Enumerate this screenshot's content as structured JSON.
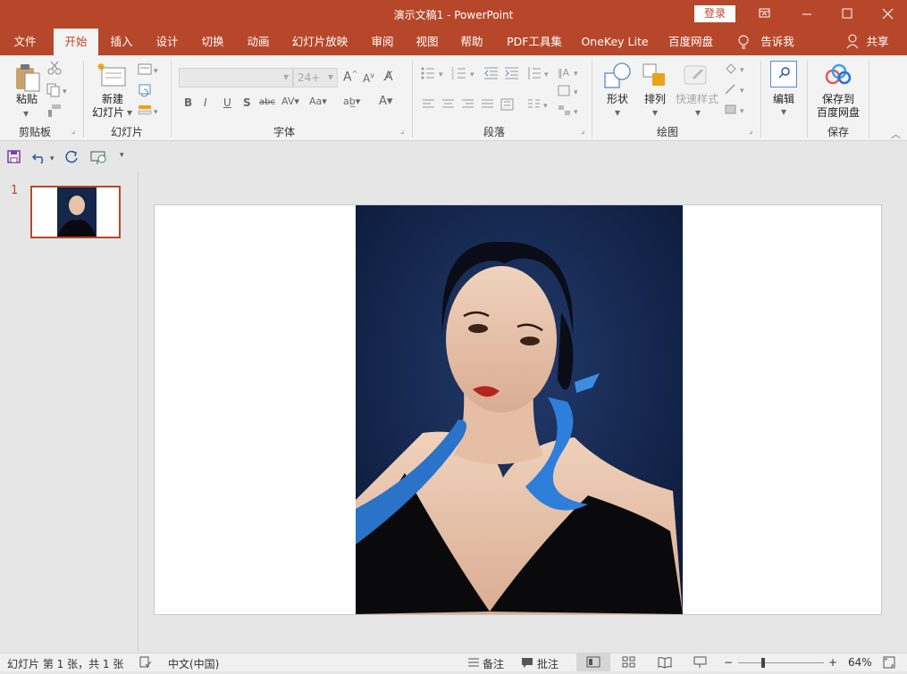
{
  "window": {
    "title": "演示文稿1  -  PowerPoint",
    "login": "登录"
  },
  "menu": {
    "tabs": [
      "文件",
      "开始",
      "插入",
      "设计",
      "切换",
      "动画",
      "幻灯片放映",
      "审阅",
      "视图",
      "帮助",
      "PDF工具集",
      "OneKey Lite",
      "百度网盘"
    ],
    "tell_me": "告诉我",
    "share": "共享"
  },
  "ribbon": {
    "clipboard": {
      "paste": "粘贴",
      "group": "剪贴板"
    },
    "slides": {
      "new_slide_1": "新建",
      "new_slide_2": "幻灯片",
      "group": "幻灯片"
    },
    "font": {
      "font_size": "24+",
      "group": "字体",
      "bold": "B",
      "italic": "I",
      "underline": "U",
      "shadow": "S",
      "strike": "abc"
    },
    "paragraph": {
      "group": "段落"
    },
    "drawing": {
      "shapes": "形状",
      "arrange": "排列",
      "quick_styles": "快速样式",
      "group": "绘图"
    },
    "editing": {
      "label": "编辑"
    },
    "save": {
      "label_1": "保存到",
      "label_2": "百度网盘",
      "group": "保存"
    }
  },
  "thumbnails": {
    "slide_number": "1"
  },
  "status": {
    "slide_info": "幻灯片 第 1 张，共 1 张",
    "language": "中文(中国)",
    "notes": "备注",
    "comments": "批注",
    "zoom": "64%"
  },
  "colors": {
    "accent": "#b7472a",
    "ribbon": "#f3f3f3",
    "background": "#e6e6e6"
  }
}
